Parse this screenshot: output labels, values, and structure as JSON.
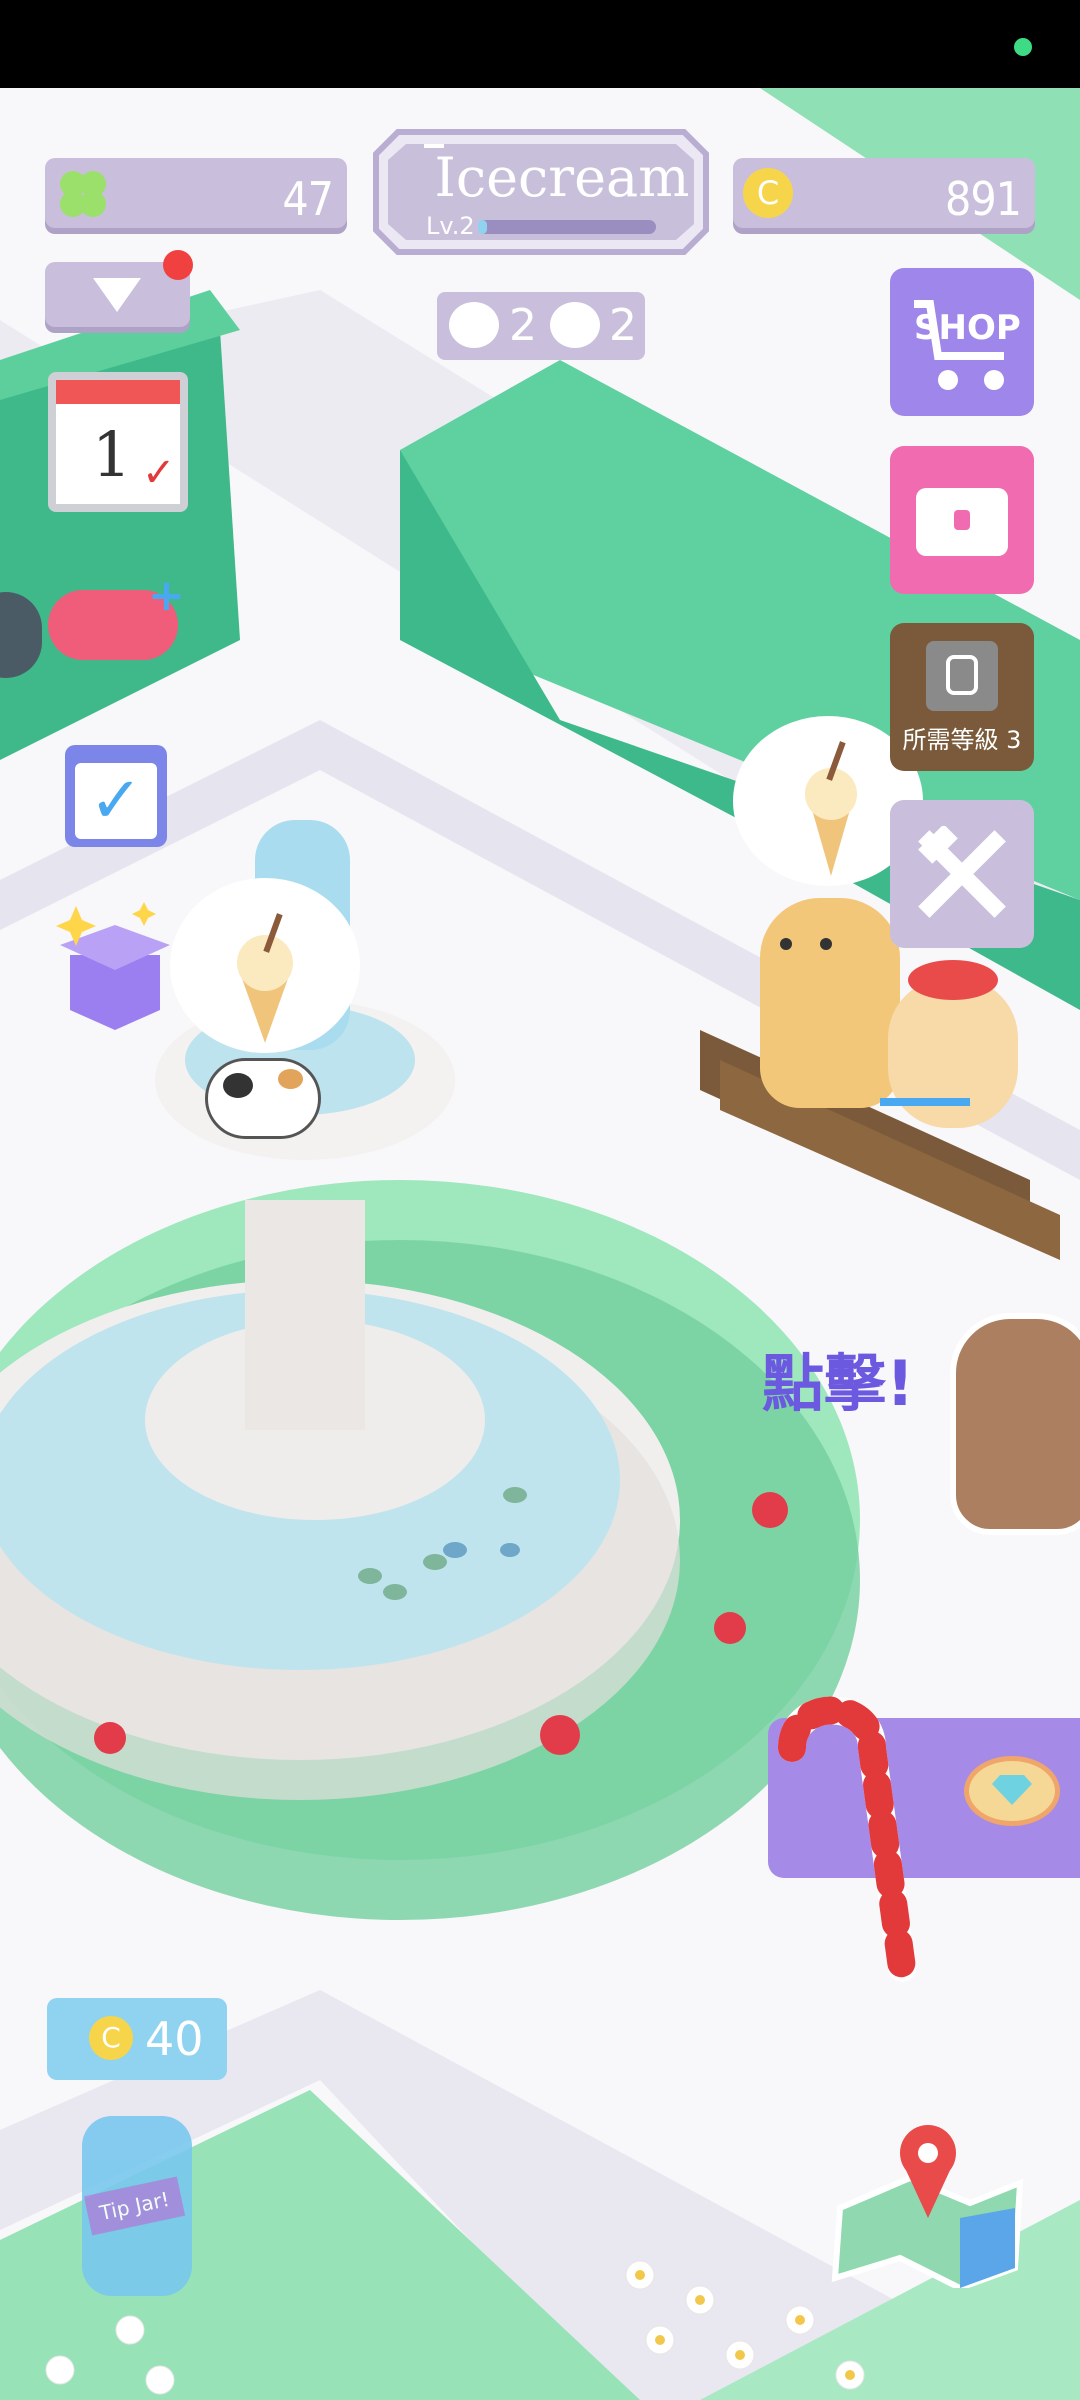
{
  "hud": {
    "clover_count": "47",
    "title": "Icecream",
    "level": "Lv.2",
    "coins": "891",
    "dog_count": "2",
    "cat_count": "2",
    "level_progress": 0.05
  },
  "side_menu": {
    "shop_label": "SHOP",
    "locked_label": "所需等級 3"
  },
  "scene": {
    "tap_prompt": "點擊!",
    "tip_jar_coins": "40",
    "tip_jar_label": "Tip Jar!"
  },
  "calendar": {
    "day": "1"
  },
  "colors": {
    "accent_purple": "#9f86ea",
    "hud_lavender": "#c9bfdc",
    "hedge_green": "#4fc69a",
    "gift_pink": "#f06bb0",
    "locked_brown": "#7a5a3a"
  }
}
